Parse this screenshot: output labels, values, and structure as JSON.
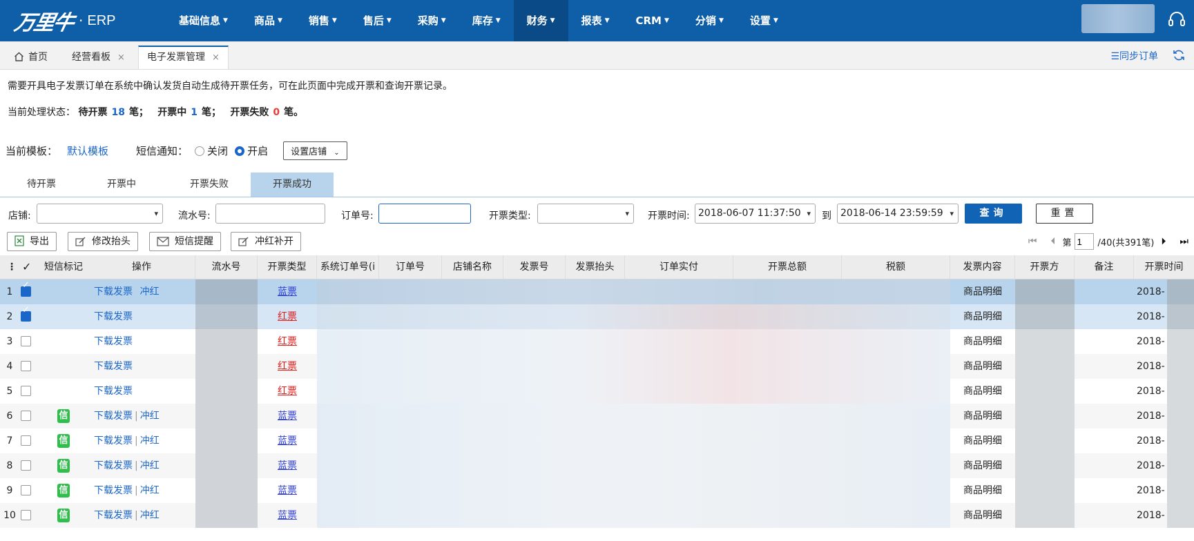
{
  "app": {
    "logo_mark": "万里牛",
    "logo_dot": "·",
    "logo_text": "ERP",
    "nav": [
      {
        "label": "基础信息"
      },
      {
        "label": "商品"
      },
      {
        "label": "销售"
      },
      {
        "label": "售后"
      },
      {
        "label": "采购"
      },
      {
        "label": "库存"
      },
      {
        "label": "财务"
      },
      {
        "label": "报表"
      },
      {
        "label": "CRM"
      },
      {
        "label": "分销"
      },
      {
        "label": "设置"
      }
    ],
    "active_nav": "财务"
  },
  "tabs": {
    "home": "首页",
    "t1": "经营看板",
    "t2": "电子发票管理",
    "close": "×",
    "sync_orders": "☰同步订单"
  },
  "info": {
    "line1": "需要开具电子发票订单在系统中确认发货自动生成待开票任务，可在此页面中完成开票和查询开票记录。",
    "status_label": "当前处理状态：",
    "pending_label": "待开票",
    "pending_count": "18",
    "unit1": "笔；",
    "issuing_label": "开票中",
    "issuing_count": "1",
    "unit2": "笔；",
    "failed_label": "开票失败",
    "failed_count": "0",
    "unit3": "笔。"
  },
  "template": {
    "label": "当前模板：",
    "link": "默认模板",
    "sms_label": "短信通知：",
    "off": "关闭",
    "on": "开启",
    "shop_setting": "设置店铺"
  },
  "status_tabs": [
    "待开票",
    "开票中",
    "开票失败",
    "开票成功"
  ],
  "filter": {
    "shop_label": "店铺:",
    "serial_label": "流水号:",
    "order_label": "订单号:",
    "type_label": "开票类型:",
    "time_label": "开票时间:",
    "time_from": "2018-06-07 11:37:50",
    "to_label": "到",
    "time_to": "2018-06-14 23:59:59",
    "query": "查询",
    "reset": "重置"
  },
  "toolbar": {
    "export": "导出",
    "modify_header": "修改抬头",
    "sms_remind": "短信提醒",
    "red_reissue": "冲红补开"
  },
  "pager": {
    "page_prefix": "第",
    "page": "1",
    "suffix": "/40(共391笔)"
  },
  "columns": {
    "dots": "⋮",
    "check": "✓",
    "sms": "短信标记",
    "ops": "操作",
    "serial": "流水号",
    "type": "开票类型",
    "sys_order": "系统订单号(i",
    "order": "订单号",
    "shop": "店铺名称",
    "invoice_no": "发票号",
    "invoice_header": "发票抬头",
    "paid": "订单实付",
    "total": "开票总额",
    "tax": "税额",
    "content": "发票内容",
    "issuer": "开票方",
    "remark": "备注",
    "time": "开票时间"
  },
  "rows": [
    {
      "n": "1",
      "checked": true,
      "sms": "",
      "download": "下载发票",
      "reverse": "冲红",
      "type": "蓝票",
      "color": "blue",
      "content": "商品明细",
      "time": "2018-"
    },
    {
      "n": "2",
      "checked": true,
      "sms": "",
      "download": "下载发票",
      "reverse": "",
      "type": "红票",
      "color": "red",
      "content": "商品明细",
      "time": "2018-"
    },
    {
      "n": "3",
      "checked": false,
      "sms": "",
      "download": "下载发票",
      "reverse": "",
      "type": "红票",
      "color": "red",
      "content": "商品明细",
      "time": "2018-"
    },
    {
      "n": "4",
      "checked": false,
      "sms": "",
      "download": "下载发票",
      "reverse": "",
      "type": "红票",
      "color": "red",
      "content": "商品明细",
      "time": "2018-"
    },
    {
      "n": "5",
      "checked": false,
      "sms": "",
      "download": "下载发票",
      "reverse": "",
      "type": "红票",
      "color": "red",
      "content": "商品明细",
      "time": "2018-"
    },
    {
      "n": "6",
      "checked": false,
      "sms": "信",
      "download": "下载发票",
      "reverse": "冲红",
      "type": "蓝票",
      "color": "blue",
      "content": "商品明细",
      "time": "2018-"
    },
    {
      "n": "7",
      "checked": false,
      "sms": "信",
      "download": "下载发票",
      "reverse": "冲红",
      "type": "蓝票",
      "color": "blue",
      "content": "商品明细",
      "time": "2018-"
    },
    {
      "n": "8",
      "checked": false,
      "sms": "信",
      "download": "下载发票",
      "reverse": "冲红",
      "type": "蓝票",
      "color": "blue",
      "content": "商品明细",
      "time": "2018-"
    },
    {
      "n": "9",
      "checked": false,
      "sms": "信",
      "download": "下载发票",
      "reverse": "冲红",
      "type": "蓝票",
      "color": "blue",
      "content": "商品明细",
      "time": "2018-"
    },
    {
      "n": "10",
      "checked": false,
      "sms": "信",
      "download": "下载发票",
      "reverse": "冲红",
      "type": "蓝票",
      "color": "blue",
      "content": "商品明细",
      "time": "2018-"
    }
  ],
  "colors": {
    "brand": "#0f5fa8",
    "link": "#1b66c9",
    "selected_row": "#b7d4ec",
    "sms_badge": "#2dbf4a"
  }
}
